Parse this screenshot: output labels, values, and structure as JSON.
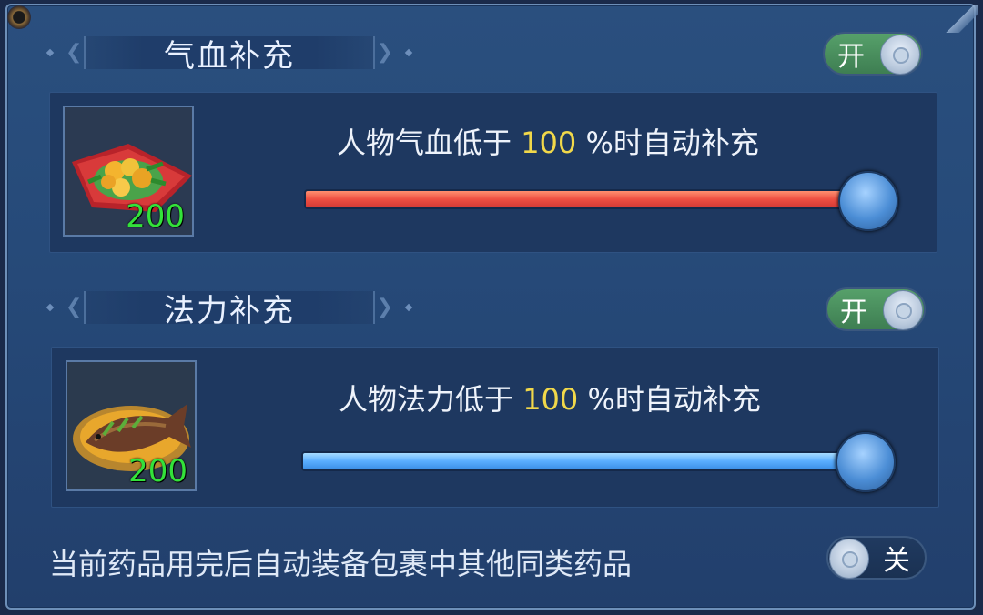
{
  "hp_section": {
    "title": "气血补充",
    "toggle_label": "开",
    "item_icon": "food-dish-icon",
    "item_count": "200",
    "slider_text_prefix": "人物气血低于 ",
    "slider_value": "100",
    "slider_text_suffix": " %时自动补充",
    "slider_percent": 100,
    "slider_color": "#ee4f42"
  },
  "mp_section": {
    "title": "法力补充",
    "toggle_label": "开",
    "item_icon": "fish-dish-icon",
    "item_count": "200",
    "slider_text_prefix": "人物法力低于 ",
    "slider_value": "100",
    "slider_text_suffix": " %时自动补充",
    "slider_percent": 100,
    "slider_color": "#5aaeff"
  },
  "auto_equip": {
    "text": "当前药品用完后自动装备包裹中其他同类药品",
    "toggle_label": "关"
  }
}
